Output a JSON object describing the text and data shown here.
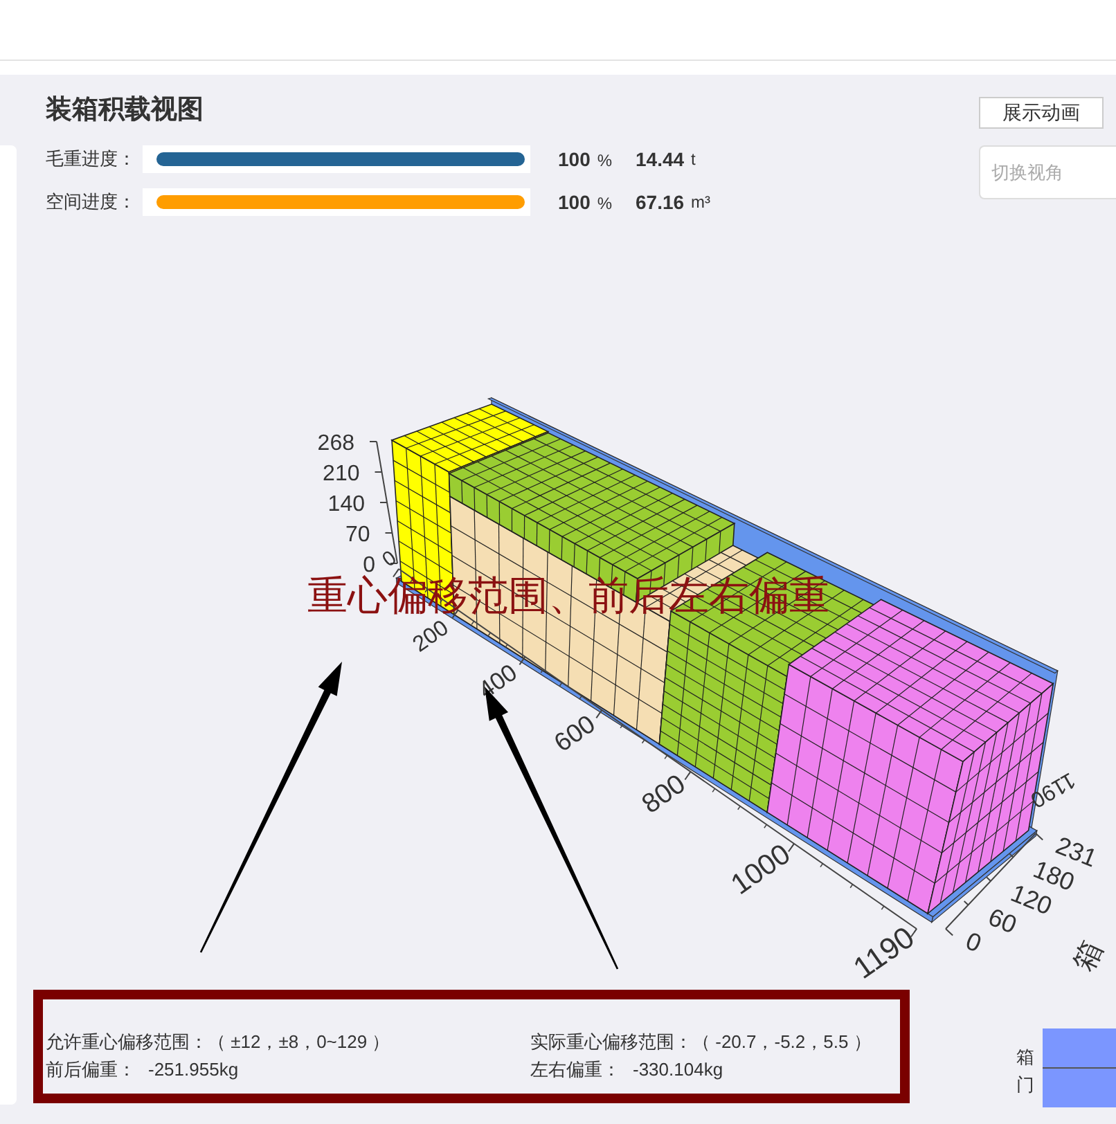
{
  "title": "装箱积载视图",
  "progress": [
    {
      "label": "毛重进度：",
      "level": 1,
      "color": "#246494",
      "percent": "100",
      "percent_unit": "%",
      "amount": "14.44",
      "amount_unit": "t"
    },
    {
      "label": "空间进度：",
      "level": 1,
      "color": "#ff9d00",
      "percent": "100",
      "percent_unit": "%",
      "amount": "67.16",
      "amount_unit": "m³"
    }
  ],
  "actions": {
    "animate_button": "展示动画",
    "view_select": {
      "placeholder": "切换视角"
    }
  },
  "scene": {
    "height_ticks": [
      "268",
      "210",
      "140",
      "70",
      "0"
    ],
    "length_ticks": [
      "0",
      "200",
      "400",
      "600",
      "800",
      "1000",
      "1190"
    ],
    "width_ticks": [
      "0",
      "60",
      "120",
      "180",
      "231"
    ],
    "far_corner_label": "1190",
    "width_axis_title": "箱"
  },
  "annotation": "重心偏移范围、前后左右偏重",
  "center_of_gravity": {
    "allowed": "允许重心偏移范围：（ ±12，±8，0~129 ）",
    "actual": "实际重心偏移范围：（ -20.7，-5.2，5.5 ）",
    "front_back": {
      "label": "前后偏重：",
      "value": "-251.955kg"
    },
    "left_right": {
      "label": "左右偏重：",
      "value": "-330.104kg"
    }
  },
  "door_legend": {
    "label": "箱门"
  }
}
